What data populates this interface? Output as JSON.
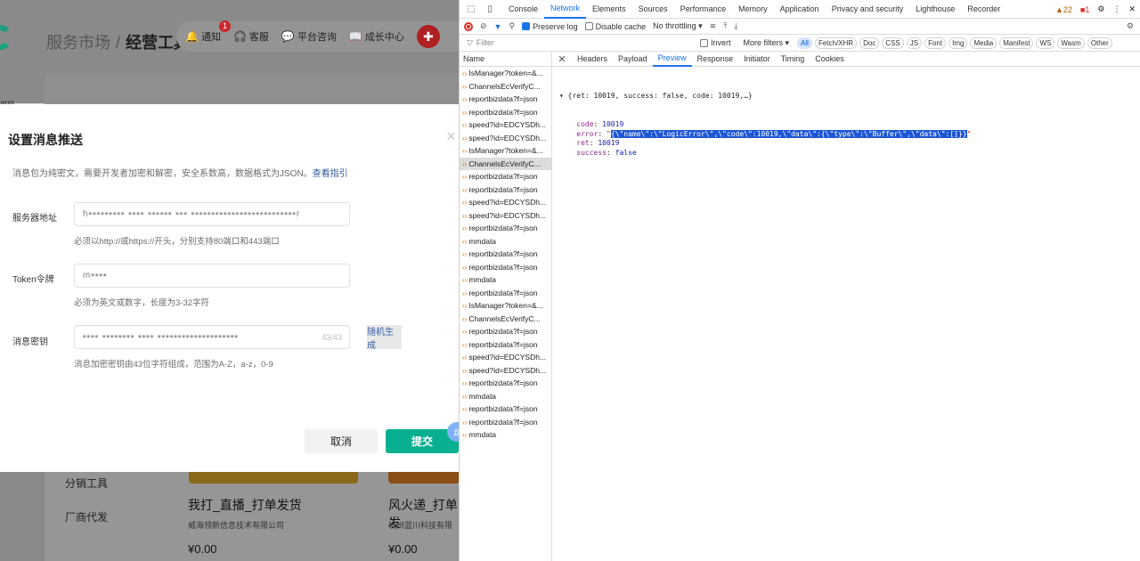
{
  "app": {
    "breadcrumb": {
      "parent": "服务市场",
      "separator": "/",
      "current": "经营工具"
    },
    "topnav": [
      {
        "icon": "bell-icon",
        "glyph": "🔔",
        "label": "通知",
        "badge": "1"
      },
      {
        "icon": "headset-icon",
        "glyph": "🎧",
        "label": "客服"
      },
      {
        "icon": "chat-icon",
        "glyph": "💬",
        "label": "平台咨询"
      },
      {
        "icon": "book-icon",
        "glyph": "📖",
        "label": "成长中心"
      }
    ],
    "side_fragment": "模理",
    "dialog": {
      "title": "设置消息推送",
      "close_glyph": "×",
      "description": "消息包为纯密文，需要开发者加密和解密，安全系数高，数据格式为JSON。",
      "guide_link": "查看指引",
      "fields": [
        {
          "label": "服务器地址",
          "value": "h▪▪▪▪▪▪▪▪▪ ▪▪▪▪ ▪▪▪▪▪▪ ▪▪▪ ▪▪▪▪▪▪▪▪▪▪▪▪▪▪▪▪▪▪▪▪▪▪▪▪▪▪r",
          "hint": "必须以http://或https://开头，分别支持80端口和443端口"
        },
        {
          "label": "Token令牌",
          "value": "m▪▪▪▪",
          "hint": "必须为英文或数字，长度为3-32字符"
        },
        {
          "label": "消息密钥",
          "value": "▪▪▪▪ ▪▪▪▪▪▪▪▪ ▪▪▪▪ ▪▪▪▪▪▪▪▪▪▪▪▪▪▪▪▪▪▪▪▪",
          "count": "43/43",
          "hint": "消息加密密钥由43位字符组成，范围为A-Z，a-z，0-9"
        }
      ],
      "random_button": "随机生成",
      "cancel_button": "取消",
      "submit_button": "提交"
    },
    "lower": {
      "menu": [
        "分销工具",
        "厂商代发"
      ],
      "products": [
        {
          "name": "我打_直播_打单发货",
          "company": "威海领新信息技术有限公司",
          "price": "¥0.00"
        },
        {
          "name": "风火递_打单发",
          "company": "杭州蓝川科技有限",
          "price": "¥0.00"
        }
      ]
    }
  },
  "devtools": {
    "tabs": [
      "Console",
      "Network",
      "Elements",
      "Sources",
      "Performance",
      "Memory",
      "Application",
      "Privacy and security",
      "Lighthouse",
      "Recorder"
    ],
    "active_tab": "Network",
    "warnings": "22",
    "errors": "1",
    "toolbar": {
      "preserve_log": "Preserve log",
      "disable_cache": "Disable cache",
      "throttling": "No throttling ▾"
    },
    "filter": {
      "placeholder": "Filter",
      "invert": "Invert",
      "more_filters": "More filters ▾",
      "types": [
        "All",
        "Fetch/XHR",
        "Doc",
        "CSS",
        "JS",
        "Font",
        "Img",
        "Media",
        "Manifest",
        "WS",
        "Wasm",
        "Other"
      ]
    },
    "requests_header": "Name",
    "requests": [
      "IsManager?token=&...",
      "ChannelsEcVerifyC...",
      "reportbizdata?f=json",
      "reportbizdata?f=json",
      "speed?id=EDCYSDh...",
      "speed?id=EDCYSDh...",
      "IsManager?token=&...",
      "ChannelsEcVerifyC...",
      "reportbizdata?f=json",
      "reportbizdata?f=json",
      "speed?id=EDCYSDh...",
      "speed?id=EDCYSDh...",
      "reportbizdata?f=json",
      "mmdata",
      "reportbizdata?f=json",
      "reportbizdata?f=json",
      "mmdata",
      "reportbizdata?f=json",
      "IsManager?token=&...",
      "ChannelsEcVerifyC...",
      "reportbizdata?f=json",
      "reportbizdata?f=json",
      "speed?id=EDCYSDh...",
      "speed?id=EDCYSDh...",
      "reportbizdata?f=json",
      "mmdata",
      "reportbizdata?f=json",
      "reportbizdata?f=json",
      "mmdata"
    ],
    "selected_request_index": 7,
    "detail_tabs": [
      "Headers",
      "Payload",
      "Preview",
      "Response",
      "Initiator",
      "Timing",
      "Cookies"
    ],
    "active_detail_tab": "Preview",
    "preview": {
      "summary": "▾ {ret: 10019, success: false, code: 10019,…}",
      "lines": [
        {
          "key": "code",
          "value": "10019",
          "kind": "num"
        },
        {
          "key": "error",
          "value": "\"{\\\"name\\\":\\\"LogicError\\\",\\\"code\\\":10019,\\\"data\\\":{\\\"type\\\":\\\"Buffer\\\",\\\"data\\\":[]}}\"",
          "kind": "str"
        },
        {
          "key": "ret",
          "value": "10019",
          "kind": "num"
        },
        {
          "key": "success",
          "value": "false",
          "kind": "bool"
        }
      ]
    }
  }
}
